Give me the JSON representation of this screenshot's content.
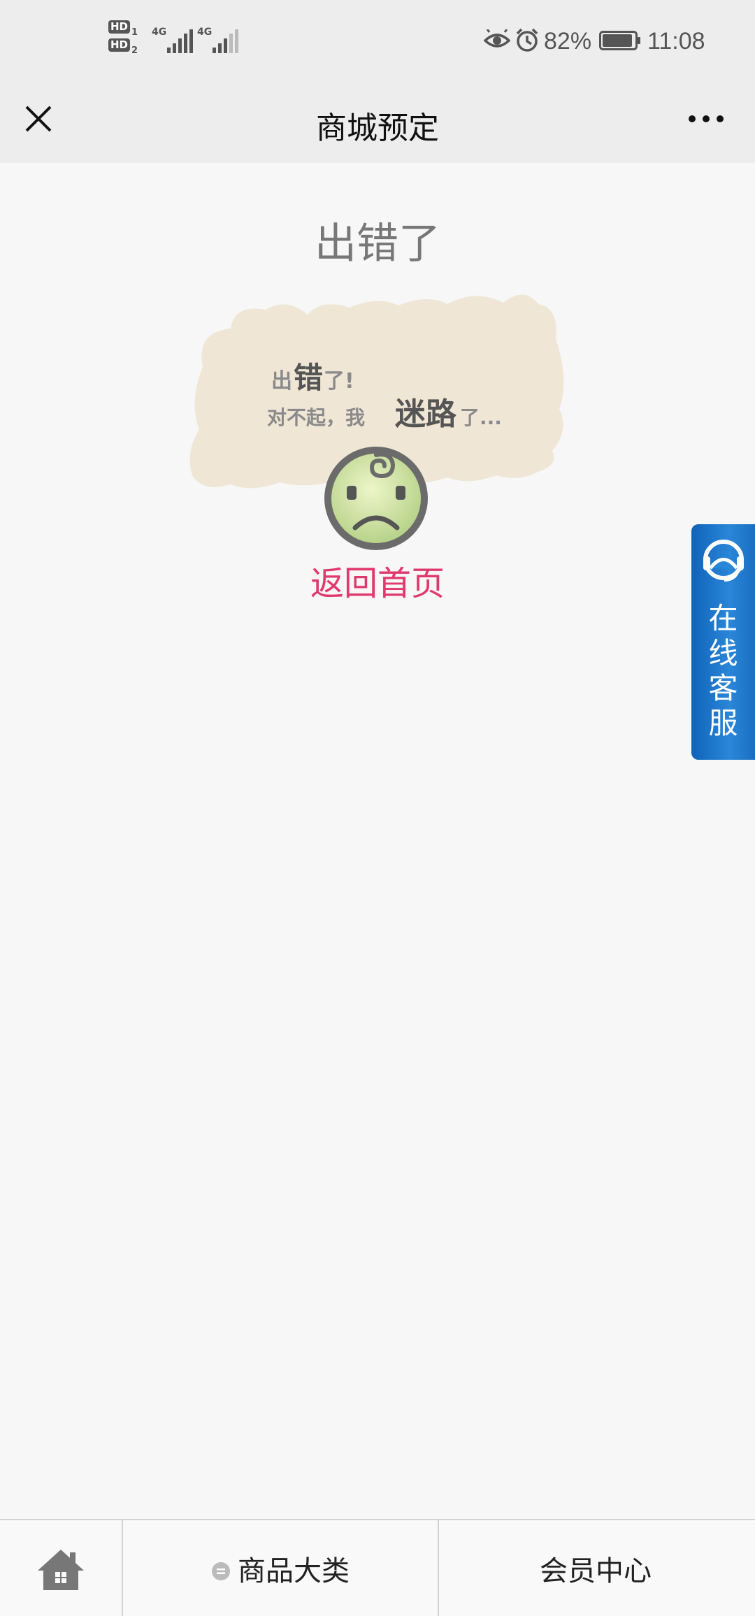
{
  "status_bar": {
    "sim1": "HD",
    "sim1_num": "1",
    "sim2": "HD",
    "sim2_num": "2",
    "net1": "4G",
    "net2": "4G",
    "battery_percent": "82%",
    "time": "11:08",
    "icons": [
      "eye-icon",
      "alarm-icon",
      "battery-icon"
    ]
  },
  "nav": {
    "title": "商城预定",
    "close_icon": "close-icon",
    "more_icon": "more-icon"
  },
  "main": {
    "heading": "出错了",
    "card": {
      "line1_small": "出",
      "line1_big": "错",
      "line1_tail": "了!",
      "line2_small": "对不起，我",
      "line2_big": "迷路",
      "line2_tail": "了..."
    },
    "return_link": "返回首页"
  },
  "customer_service": {
    "chars": [
      "在",
      "线",
      "客",
      "服"
    ]
  },
  "bottom_tabs": {
    "home_icon": "home-icon",
    "categories": "商品大类",
    "member": "会员中心"
  },
  "colors": {
    "accent_pink": "#e0396e",
    "cs_blue": "#1b74c8",
    "card_beige": "#efe6d6"
  }
}
